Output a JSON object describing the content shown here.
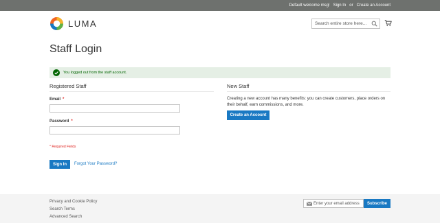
{
  "topbar": {
    "welcome": "Default welcome msg!",
    "sign_in": "Sign In",
    "or": "or",
    "create_account": "Create an Account"
  },
  "header": {
    "logo_text": "LUMA",
    "search_placeholder": "Search entire store here...",
    "icons": [
      "luma-logo-icon",
      "search-icon",
      "cart-icon"
    ]
  },
  "page": {
    "title": "Staff Login"
  },
  "message": {
    "text": "You logged out from the staff account.",
    "icon": "check-circle-icon"
  },
  "registered": {
    "title": "Registered Staff",
    "email_label": "Email",
    "password_label": "Password",
    "required_mark": "*",
    "required_note": "* Required Fields",
    "sign_in_button": "Sign In",
    "forgot_link": "Forgot Your Password?"
  },
  "new_staff": {
    "title": "New Staff",
    "description": "Creating a new account has many benefits: you can create customers, place orders on their behalf, earn commissions, and more.",
    "create_button": "Create an Account"
  },
  "footer": {
    "links": [
      "Privacy and Cookie Policy",
      "Search Terms",
      "Advanced Search"
    ],
    "newsletter_placeholder": "Enter your email address",
    "subscribe_button": "Subscribe",
    "icons": [
      "envelope-icon"
    ]
  },
  "colors": {
    "topbar_bg": "#6e716e",
    "primary_button": "#1979c3",
    "success_bg": "#e5efe5",
    "success_text": "#006400",
    "required": "#e02b27",
    "footer_bg": "#f4f4f4"
  }
}
